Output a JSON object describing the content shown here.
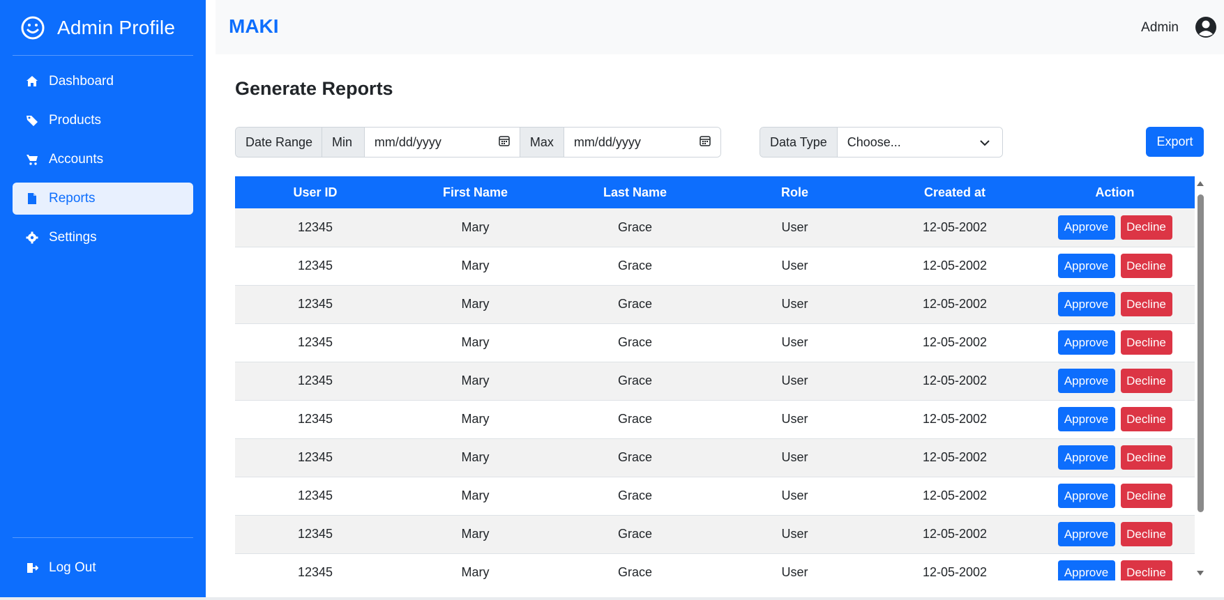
{
  "sidebar": {
    "title": "Admin Profile",
    "items": [
      {
        "label": "Dashboard",
        "icon": "home-icon"
      },
      {
        "label": "Products",
        "icon": "tag-icon"
      },
      {
        "label": "Accounts",
        "icon": "cart-icon"
      },
      {
        "label": "Reports",
        "icon": "file-icon",
        "active": true
      },
      {
        "label": "Settings",
        "icon": "gear-icon"
      }
    ],
    "logout_label": "Log Out"
  },
  "topbar": {
    "app_name": "MAKI",
    "user_name": "Admin"
  },
  "main": {
    "title": "Generate Reports",
    "filters": {
      "date_range_label": "Date Range",
      "min_label": "Min",
      "min_placeholder": "mm/dd/yyyy",
      "max_label": "Max",
      "max_placeholder": "mm/dd/yyyy",
      "data_type_label": "Data Type",
      "data_type_value": "Choose..."
    },
    "export_label": "Export",
    "table": {
      "headers": [
        "User ID",
        "First Name",
        "Last Name",
        "Role",
        "Created at",
        "Action"
      ],
      "approve_label": "Approve",
      "decline_label": "Decline",
      "rows": [
        [
          "12345",
          "Mary",
          "Grace",
          "User",
          "12-05-2002"
        ],
        [
          "12345",
          "Mary",
          "Grace",
          "User",
          "12-05-2002"
        ],
        [
          "12345",
          "Mary",
          "Grace",
          "User",
          "12-05-2002"
        ],
        [
          "12345",
          "Mary",
          "Grace",
          "User",
          "12-05-2002"
        ],
        [
          "12345",
          "Mary",
          "Grace",
          "User",
          "12-05-2002"
        ],
        [
          "12345",
          "Mary",
          "Grace",
          "User",
          "12-05-2002"
        ],
        [
          "12345",
          "Mary",
          "Grace",
          "User",
          "12-05-2002"
        ],
        [
          "12345",
          "Mary",
          "Grace",
          "User",
          "12-05-2002"
        ],
        [
          "12345",
          "Mary",
          "Grace",
          "User",
          "12-05-2002"
        ],
        [
          "12345",
          "Mary",
          "Grace",
          "User",
          "12-05-2002"
        ]
      ]
    }
  },
  "colors": {
    "primary": "#0d6efd",
    "danger": "#dc3545",
    "sidebar_active_bg": "#e8f0fe"
  }
}
